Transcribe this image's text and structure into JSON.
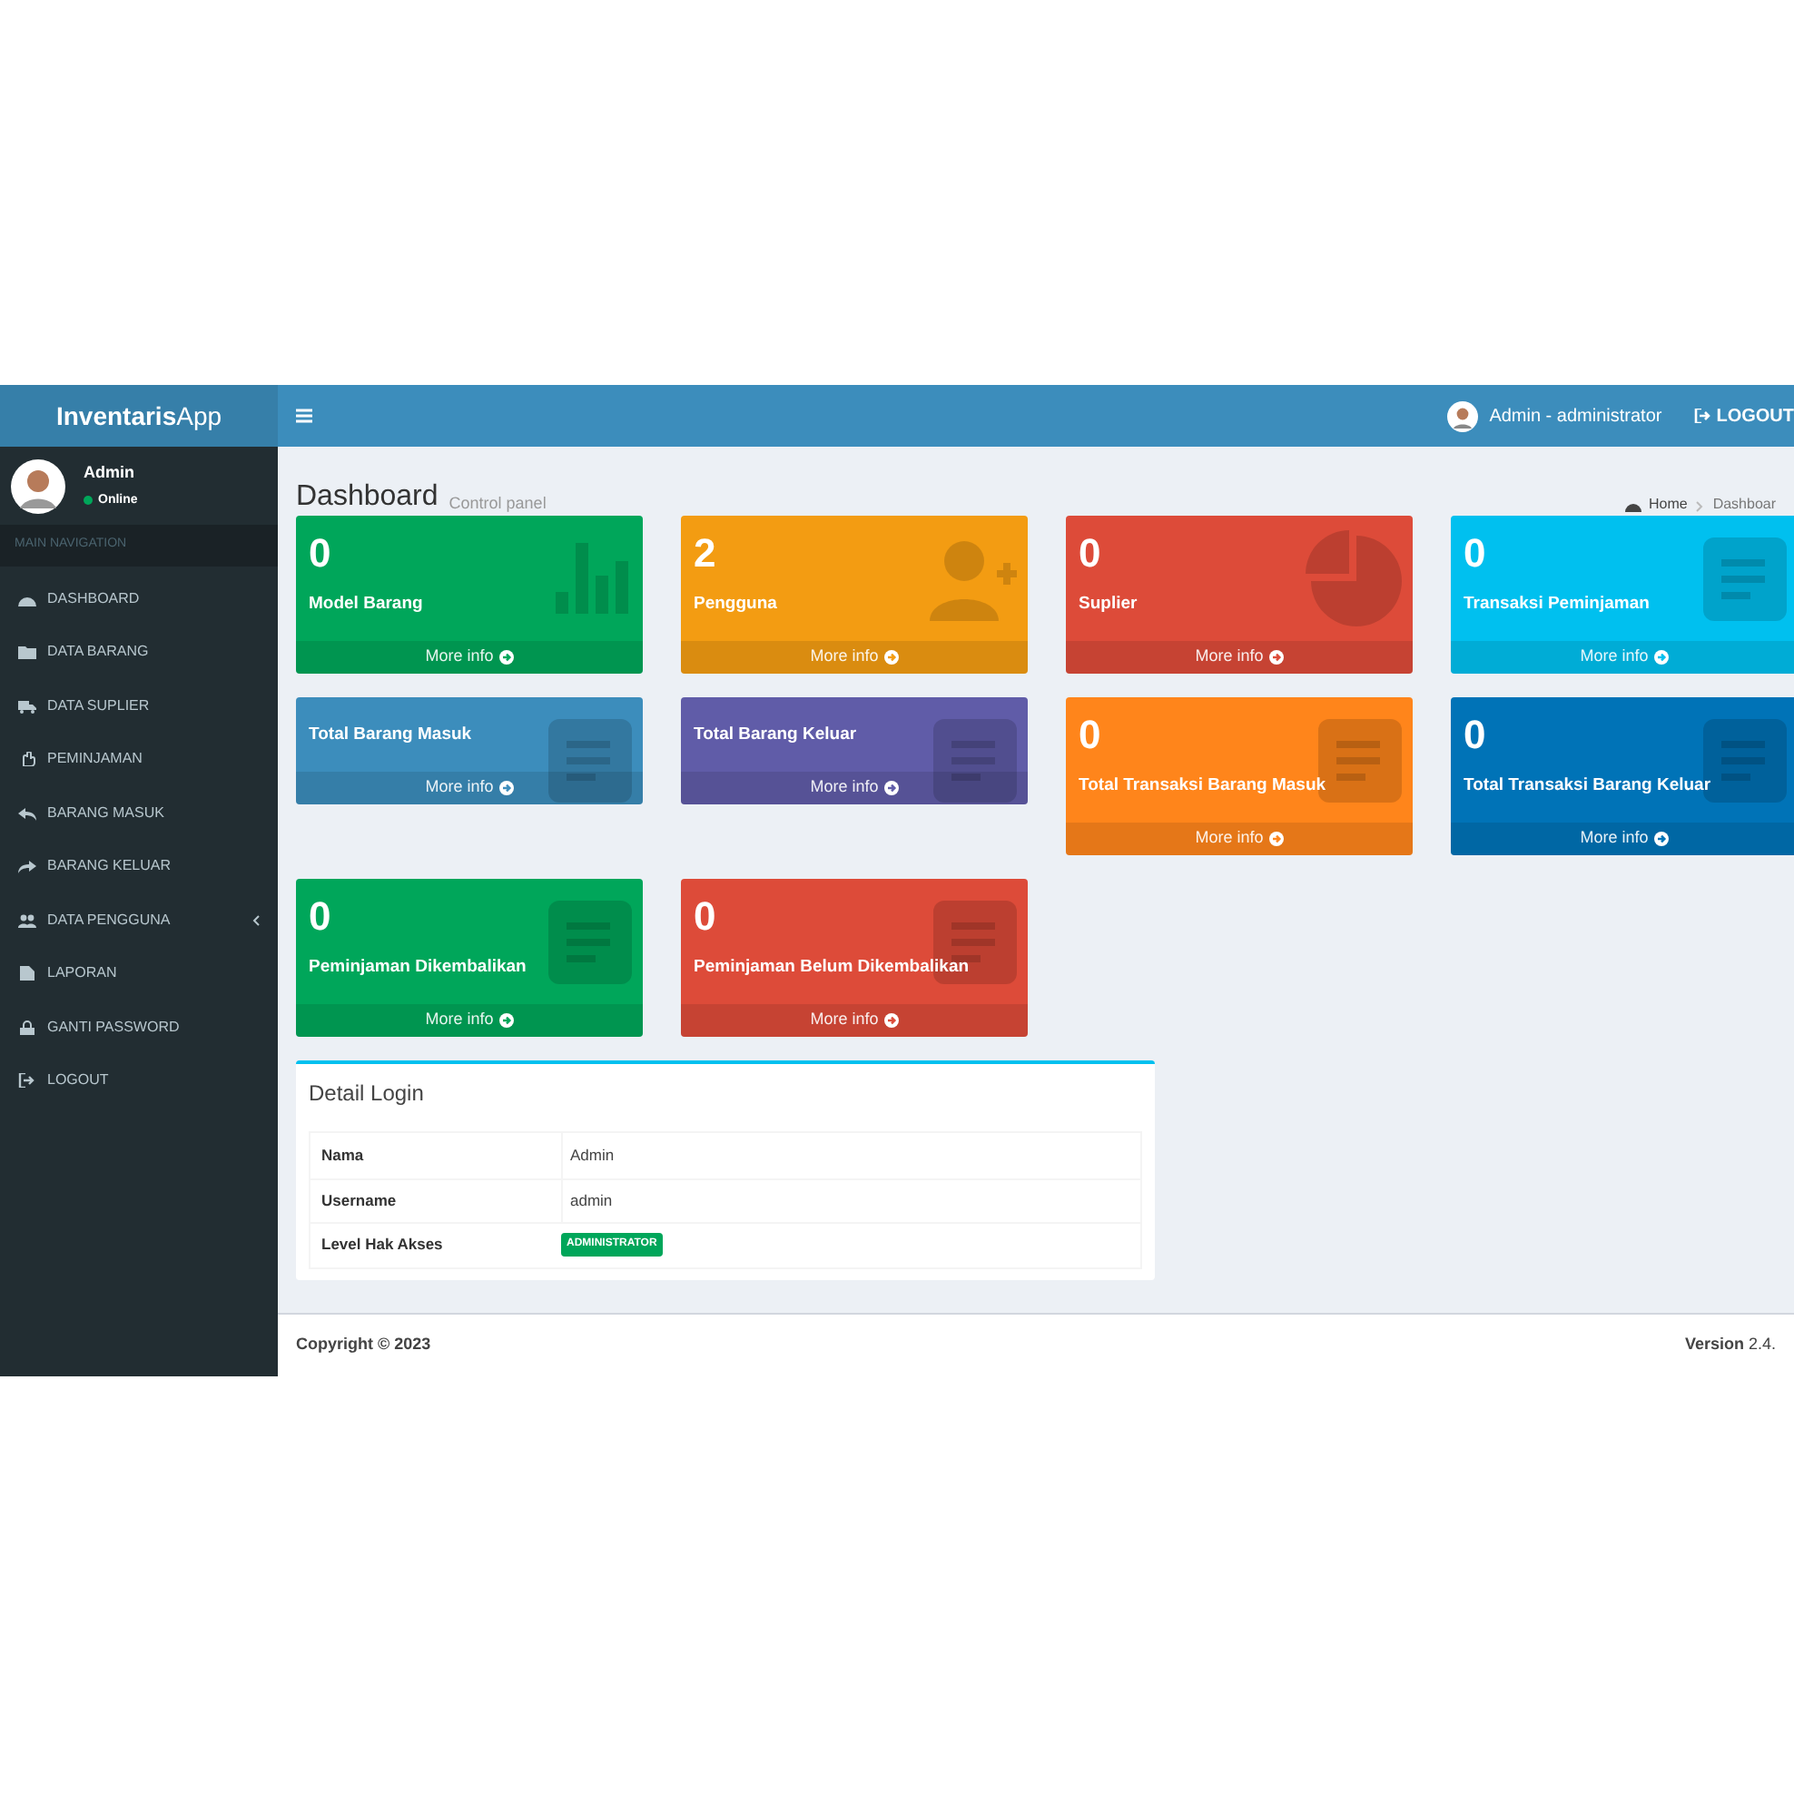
{
  "brand": {
    "bold": "Inventaris",
    "light": "App"
  },
  "user_panel": {
    "name": "Admin",
    "status": "Online"
  },
  "sidebar": {
    "header": "MAIN NAVIGATION",
    "items": [
      {
        "label": "DASHBOARD",
        "has_submenu": false
      },
      {
        "label": "DATA BARANG",
        "has_submenu": false
      },
      {
        "label": "DATA SUPLIER",
        "has_submenu": false
      },
      {
        "label": "PEMINJAMAN",
        "has_submenu": false
      },
      {
        "label": "BARANG MASUK",
        "has_submenu": false
      },
      {
        "label": "BARANG KELUAR",
        "has_submenu": false
      },
      {
        "label": "DATA PENGGUNA",
        "has_submenu": true
      },
      {
        "label": "LAPORAN",
        "has_submenu": false
      },
      {
        "label": "GANTI PASSWORD",
        "has_submenu": false
      },
      {
        "label": "LOGOUT",
        "has_submenu": false
      }
    ]
  },
  "topbar": {
    "user": "Admin - administrator",
    "logout": "LOGOUT"
  },
  "page": {
    "title": "Dashboard",
    "subtitle": "Control panel",
    "breadcrumb": [
      "Home",
      "Dashboar"
    ]
  },
  "cards": [
    {
      "number": "0",
      "label": "Model Barang",
      "color": "#00a65a",
      "link": "More info"
    },
    {
      "number": "2",
      "label": "Pengguna",
      "color": "#f39c12",
      "link": "More info"
    },
    {
      "number": "0",
      "label": "Suplier",
      "color": "#dd4b39",
      "link": "More info"
    },
    {
      "number": "0",
      "label": "Transaksi Peminjaman",
      "color": "#00c0ef",
      "link": "More info"
    },
    {
      "label": "Total Barang Masuk",
      "color": "#3c8dbc",
      "link": "More info"
    },
    {
      "label": "Total Barang Keluar",
      "color": "#605ca8",
      "link": "More info"
    },
    {
      "number": "0",
      "label": "Total Transaksi Barang Masuk",
      "color": "#ff851b",
      "link": "More info"
    },
    {
      "number": "0",
      "label": "Total Transaksi Barang Keluar",
      "color": "#0073b7",
      "link": "More info"
    },
    {
      "number": "0",
      "label": "Peminjaman Dikembalikan",
      "color": "#00a65a",
      "link": "More info"
    },
    {
      "number": "0",
      "label": "Peminjaman Belum Dikembalikan",
      "color": "#dd4b39",
      "link": "More info"
    }
  ],
  "detail_login": {
    "title": "Detail Login",
    "rows": [
      {
        "label": "Nama",
        "value": "Admin",
        "kind": "text"
      },
      {
        "label": "Username",
        "value": "admin",
        "kind": "text"
      },
      {
        "label": "Level Hak Akses",
        "value": "ADMINISTRATOR",
        "kind": "badge"
      }
    ]
  },
  "footer": {
    "copyright": "Copyright © 2023",
    "version": "**Version** 2.4."
  }
}
